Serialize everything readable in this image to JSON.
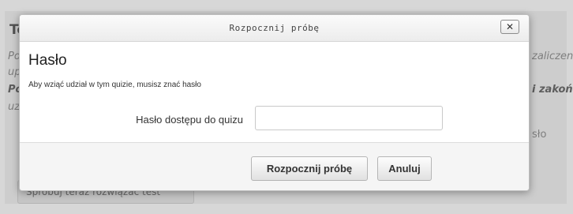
{
  "background": {
    "title": "Te",
    "lines": [
      "Po",
      "up",
      "Po",
      "uz"
    ],
    "right_lines": [
      "zaliczen",
      "i zakoń",
      "sło"
    ],
    "button_label": "Spróbuj teraz rozwiązać test"
  },
  "dialog": {
    "title": "Rozpocznij próbę",
    "close_label": "✕",
    "heading": "Hasło",
    "description": "Aby wziąć udział w tym quizie, musisz znać hasło",
    "field": {
      "label": "Hasło dostępu do quizu",
      "value": "",
      "placeholder": ""
    },
    "buttons": {
      "start": "Rozpocznij próbę",
      "cancel": "Anuluj"
    }
  }
}
